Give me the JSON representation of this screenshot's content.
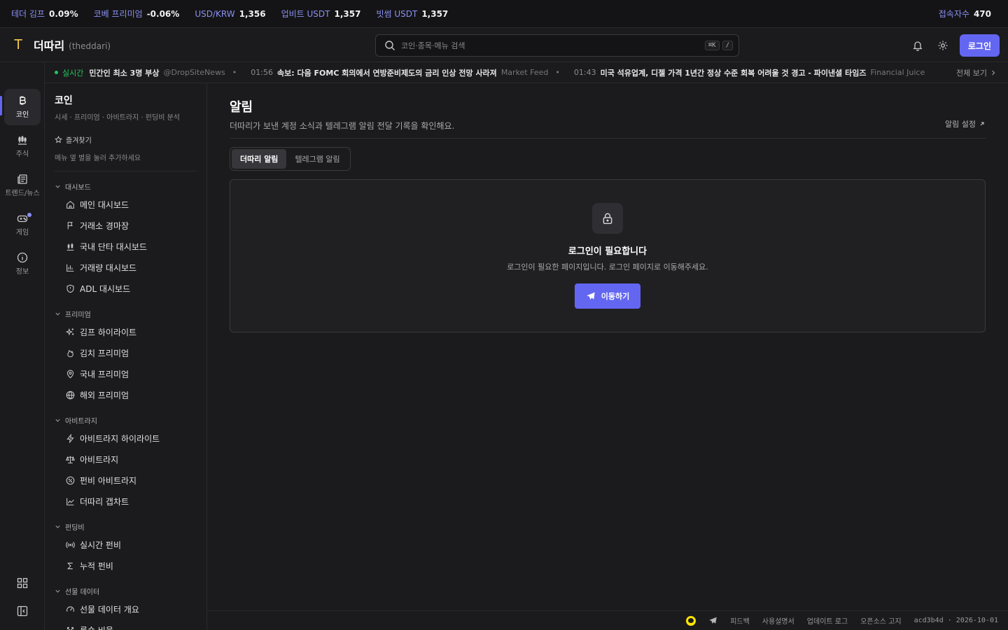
{
  "ticker": {
    "items": [
      {
        "label": "테더 김프",
        "value": "0.09%"
      },
      {
        "label": "코베 프리미엄",
        "value": "-0.06%"
      },
      {
        "label": "USD/KRW",
        "value": "1,356"
      },
      {
        "label": "업비트 USDT",
        "value": "1,357"
      },
      {
        "label": "빗썸 USDT",
        "value": "1,357"
      }
    ],
    "visitors_label": "접속자수",
    "visitors_value": "470"
  },
  "header": {
    "logo_letter": "T",
    "brand": "더따리",
    "brand_sub": "(theddari)",
    "search_placeholder": "코인·종목·메뉴 검색",
    "shortcut_key": "⌘K",
    "shortcut_slash": "/",
    "login_label": "로그인"
  },
  "news": {
    "live_label": "실시간",
    "items": [
      {
        "time": "",
        "title": "민간인 최소 3명 부상",
        "source": "@DropSiteNews"
      },
      {
        "time": "01:56",
        "title": "속보: 다음 FOMC 회의에서 연방준비제도의 금리 인상 전망 사라져",
        "source": "Market Feed"
      },
      {
        "time": "01:43",
        "title": "미국 석유업계, 디젤 가격 1년간 정상 수준 회복 어려울 것 경고 - 파이낸셜 타임즈",
        "source": "Financial Juice"
      }
    ],
    "view_all": "전체 보기"
  },
  "rail": {
    "items": [
      {
        "label": "코인",
        "icon": "bitcoin-icon"
      },
      {
        "label": "주식",
        "icon": "candlestick-icon"
      },
      {
        "label": "트렌드/뉴스",
        "icon": "newspaper-icon"
      },
      {
        "label": "게임",
        "icon": "gamepad-icon"
      },
      {
        "label": "정보",
        "icon": "info-icon"
      }
    ]
  },
  "sidebar": {
    "title": "코인",
    "subtitle": "시세 · 프리미엄 · 아비트라지 · 펀딩비 분석",
    "favorites_label": "즐겨찾기",
    "favorites_desc": "메뉴 옆 별을 눌러 추가하세요",
    "groups": [
      {
        "label": "대시보드",
        "items": [
          {
            "label": "메인 대시보드",
            "icon": "home-icon"
          },
          {
            "label": "거래소 경마장",
            "icon": "flag-icon"
          },
          {
            "label": "국내 단타 대시보드",
            "icon": "candlestick-icon"
          },
          {
            "label": "거래량 대시보드",
            "icon": "bar-chart-icon"
          },
          {
            "label": "ADL 대시보드",
            "icon": "shield-icon"
          }
        ]
      },
      {
        "label": "프리미엄",
        "items": [
          {
            "label": "김프 하이라이트",
            "icon": "sparkles-icon"
          },
          {
            "label": "김치 프리미엄",
            "icon": "flame-icon"
          },
          {
            "label": "국내 프리미엄",
            "icon": "map-pin-icon"
          },
          {
            "label": "해외 프리미엄",
            "icon": "globe-icon"
          }
        ]
      },
      {
        "label": "아비트라지",
        "items": [
          {
            "label": "아비트라지 하이라이트",
            "icon": "zap-icon"
          },
          {
            "label": "아비트라지",
            "icon": "scale-icon"
          },
          {
            "label": "펀비 아비트라지",
            "icon": "percent-icon"
          },
          {
            "label": "더따리 갭차트",
            "icon": "line-chart-icon"
          }
        ]
      },
      {
        "label": "펀딩비",
        "items": [
          {
            "label": "실시간 펀비",
            "icon": "radio-icon"
          },
          {
            "label": "누적 펀비",
            "icon": "sigma-icon"
          }
        ]
      },
      {
        "label": "선물 데이터",
        "items": [
          {
            "label": "선물 데이터 개요",
            "icon": "gauge-icon"
          },
          {
            "label": "롱숏 비율",
            "icon": "split-icon"
          }
        ]
      }
    ]
  },
  "main": {
    "title": "알림",
    "description": "더따리가 보낸 계정 소식과 텔레그램 알림 전달 기록을 확인해요.",
    "settings_link": "알림 설정",
    "tabs": [
      {
        "label": "더따리 알림",
        "active": true
      },
      {
        "label": "텔레그램 알림",
        "active": false
      }
    ],
    "card": {
      "title": "로그인이 필요합니다",
      "description": "로그인이 필요한 페이지입니다. 로그인 페이지로 이동해주세요.",
      "button": "이동하기"
    }
  },
  "footer": {
    "links": [
      "피드백",
      "사용설명서",
      "업데이트 로그",
      "오픈소스 고지"
    ],
    "version": "acd3b4d · 2026-10-01"
  },
  "colors": {
    "accent": "#6366f1",
    "ticker_label": "#8b8ff2",
    "live": "#22c55e",
    "logo": "#f2c94c",
    "kakao": "#fee500"
  }
}
